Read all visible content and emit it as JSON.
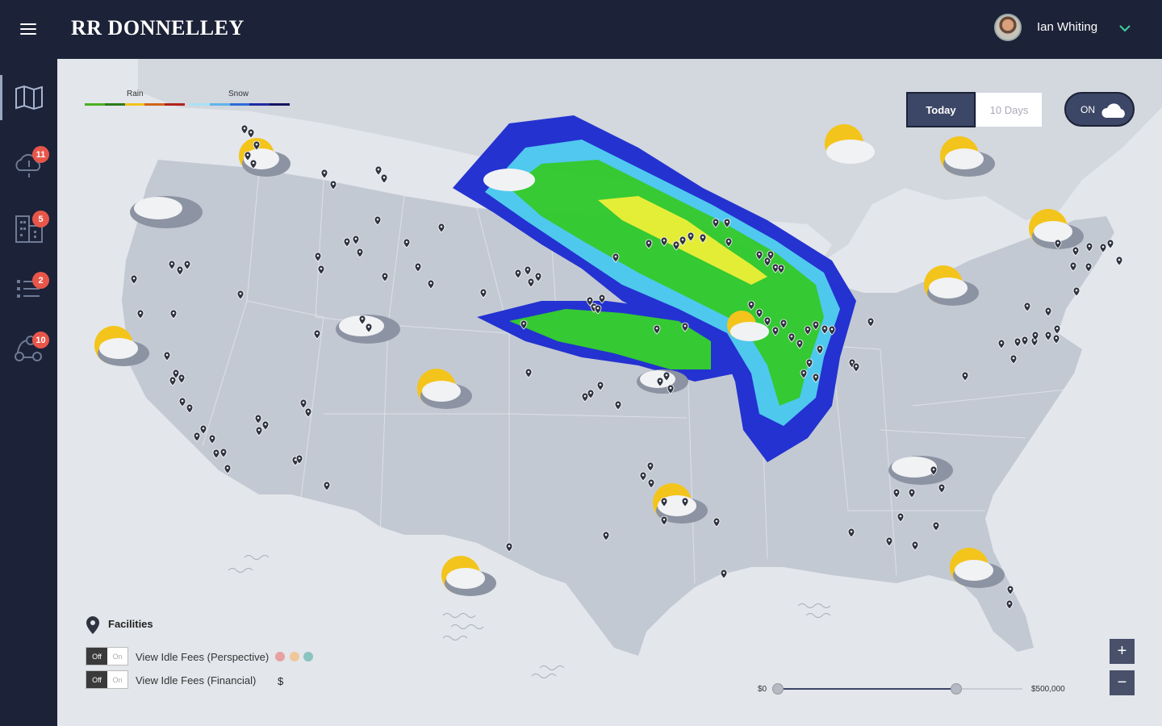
{
  "header": {
    "brand": "RR DONNELLEY",
    "user_name": "Ian Whiting"
  },
  "sidebar": {
    "items": [
      {
        "name": "map",
        "badge": null
      },
      {
        "name": "weather-alerts",
        "badge": "11"
      },
      {
        "name": "facilities",
        "badge": "5"
      },
      {
        "name": "tasks",
        "badge": "2"
      },
      {
        "name": "network",
        "badge": "10"
      }
    ]
  },
  "legend": {
    "rain_label": "Rain",
    "snow_label": "Snow",
    "rain_colors": [
      "#4caf22",
      "#2e7a1c",
      "#f2c21b",
      "#d2651b",
      "#b2211b"
    ],
    "snow_colors": [
      "#a8e2f4",
      "#5fb4ea",
      "#2d6ad8",
      "#1f2aa0",
      "#14135e"
    ]
  },
  "forecast": {
    "today_label": "Today",
    "ten_days_label": "10 Days",
    "cloud_toggle_label": "ON"
  },
  "facilities": {
    "title": "Facilities",
    "toggles": [
      {
        "off": "Off",
        "on": "On",
        "label": "View Idle Fees (Perspective)"
      },
      {
        "off": "Off",
        "on": "On",
        "label": "View Idle Fees (Financial)"
      }
    ],
    "perspective_colors": [
      "#e8a0a0",
      "#efc79a",
      "#8cc2c0"
    ],
    "financial_symbol": "$"
  },
  "slider": {
    "min_label": "$0",
    "max_label": "$500,000",
    "low_fraction": 0,
    "high_fraction": 0.73
  },
  "zoom": {
    "in_label": "+",
    "out_label": "−"
  }
}
